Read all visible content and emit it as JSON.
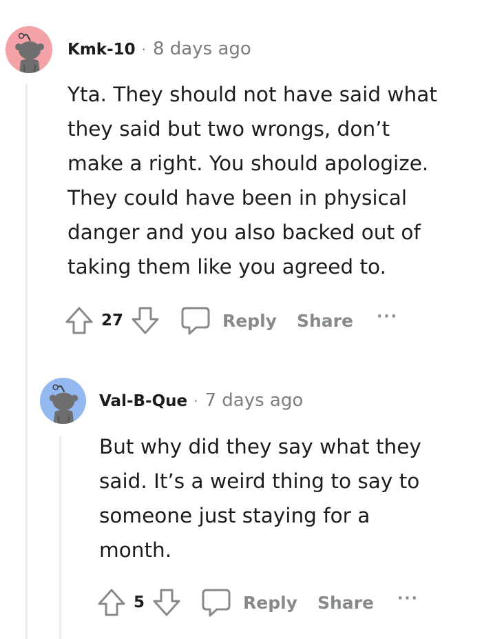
{
  "comments": [
    {
      "username": "Kmk-10",
      "separator": "·",
      "time": "8 days ago",
      "avatar_color": "#f4a1a8",
      "lines": [
        "Yta. They should not have said what",
        "they said but two wrongs, don’t",
        "make a right. You should apologize.",
        "They could have been in physical",
        "danger and you also backed out of",
        "taking them like you agreed to."
      ],
      "votes": "27",
      "reply_label": "Reply",
      "share_label": "Share",
      "more_label": "···"
    },
    {
      "username": "Val-B-Que",
      "separator": "·",
      "time": "7 days ago",
      "avatar_color": "#94b8f0",
      "lines": [
        "But why did they say what they",
        "said. It’s a weird thing to say to",
        "someone just staying for a",
        "month."
      ],
      "votes": "5",
      "reply_label": "Reply",
      "share_label": "Share",
      "more_label": "···"
    }
  ],
  "icons": {
    "upvote": "upvote-arrow-icon",
    "downvote": "downvote-arrow-icon",
    "reply": "comment-bubble-icon",
    "avatar": "snoo-avatar-icon"
  },
  "colors": {
    "text": "#1c1c1c",
    "meta": "#7c7c7c",
    "action": "#878a8c",
    "thread_line": "#ececec"
  }
}
